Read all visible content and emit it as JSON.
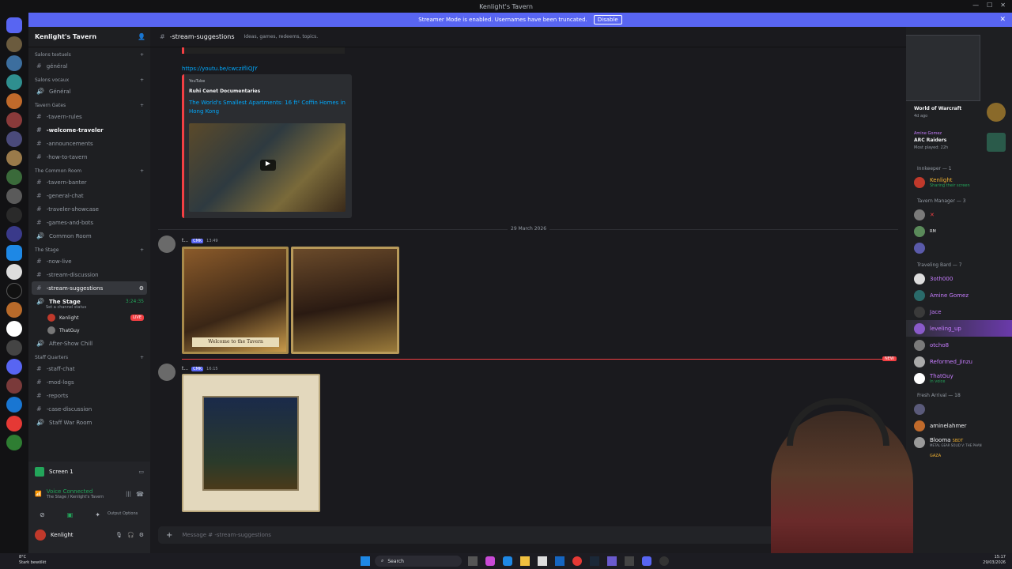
{
  "window": {
    "title": "Kenlight's Tavern"
  },
  "banner": {
    "text": "Streamer Mode is enabled. Usernames have been truncated.",
    "disable_label": "Disable"
  },
  "server": {
    "name": "Kenlight's Tavern"
  },
  "categories": {
    "text": "Salons textuels",
    "voice": "Salons vocaux",
    "gates": "Tavern Gates",
    "common": "The Common Room",
    "stage": "The Stage",
    "staff": "Staff Quarters"
  },
  "channels": {
    "general_text": "général",
    "general_voice": "Général",
    "rules": "-tavern-rules",
    "welcome": "-welcome-traveler",
    "announcements": "-announcements",
    "howto": "-how-to-tavern",
    "banter": "-tavern-banter",
    "general_chat": "-general-chat",
    "showcase": "-traveler-showcase",
    "games": "-games-and-bots",
    "common_room": "Common Room",
    "now_live": "-now-live",
    "stream_discussion": "-stream-discussion",
    "stream_suggestions": "-stream-suggestions",
    "the_stage": "The Stage",
    "stage_time": "3:24:35",
    "stage_status": "Set a channel status",
    "stage_user1": "Kenlight",
    "stage_user2": "ThatGuy",
    "live_badge": "LIVE",
    "after_show": "After-Show Chill",
    "staff_chat": "-staff-chat",
    "mod_logs": "-mod-logs",
    "reports": "-reports",
    "case_discussion": "-case-discussion",
    "war_room": "Staff War Room"
  },
  "panel": {
    "screen": "Screen 1",
    "voice_connected": "Voice Connected",
    "voice_location": "The Stage / Kenlight's Tavern",
    "output_options": "Output Options",
    "username": "Kenlight"
  },
  "header": {
    "channel": "-stream-suggestions",
    "topic": "Ideas, games, redeems, topics."
  },
  "messages": {
    "link": "https://youtu.be/cwczifliQJY",
    "embed_provider": "YouTube",
    "embed_author": "Ruhi Cenet Documentaries",
    "embed_title": "The World's Smallest Apartments: 16 ft² Coffin Homes in Hong Kong",
    "date_divider": "29 March 2026",
    "msg1_author": "t...",
    "msg1_badge": "CMK",
    "msg1_time": "13:49",
    "msg2_author": "t...",
    "msg2_badge": "CMK",
    "msg2_time": "16:15",
    "new_badge": "NEW",
    "image1_caption": "Welcome to the Tavern"
  },
  "composer": {
    "placeholder": "Message # -stream-suggestions"
  },
  "members": {
    "activity1_title": "World of Warcraft",
    "activity1_time": "4d ago",
    "activity2_user": "Amine Gomez",
    "activity2_title": "ARC Raiders",
    "activity2_time": "Most played: 22h",
    "innkeeper_cat": "Innkeeper — 1",
    "innkeeper_name": "Kenlight",
    "innkeeper_status": "Sharing their screen",
    "manager_cat": "Tavern Manager — 3",
    "manager_rm": "RM",
    "bard_cat": "Traveling Bard — 7",
    "bards": [
      "3oth000",
      "Amine Gomez",
      "Jace",
      "leveling_up",
      "otcho8",
      "Reformed_Jinzu",
      "ThatGuy"
    ],
    "thatguy_status": "In voice",
    "fresh_cat": "Fresh Arrival — 18",
    "fresh1": "aminelahmer",
    "fresh2": "Blooma",
    "fresh2_tag": "SBDT",
    "fresh2_status": "METAL GEAR SOLID V: THE PHAN",
    "gaza": "GAZA"
  },
  "taskbar": {
    "weather_temp": "8°C",
    "weather_text": "Stark bewölkt",
    "search": "Search",
    "time": "15:17",
    "date": "29/03/2026"
  },
  "colors": {
    "accent": "#5865f2",
    "live": "#f23f43",
    "green": "#23a55a",
    "link": "#00a8fc"
  }
}
